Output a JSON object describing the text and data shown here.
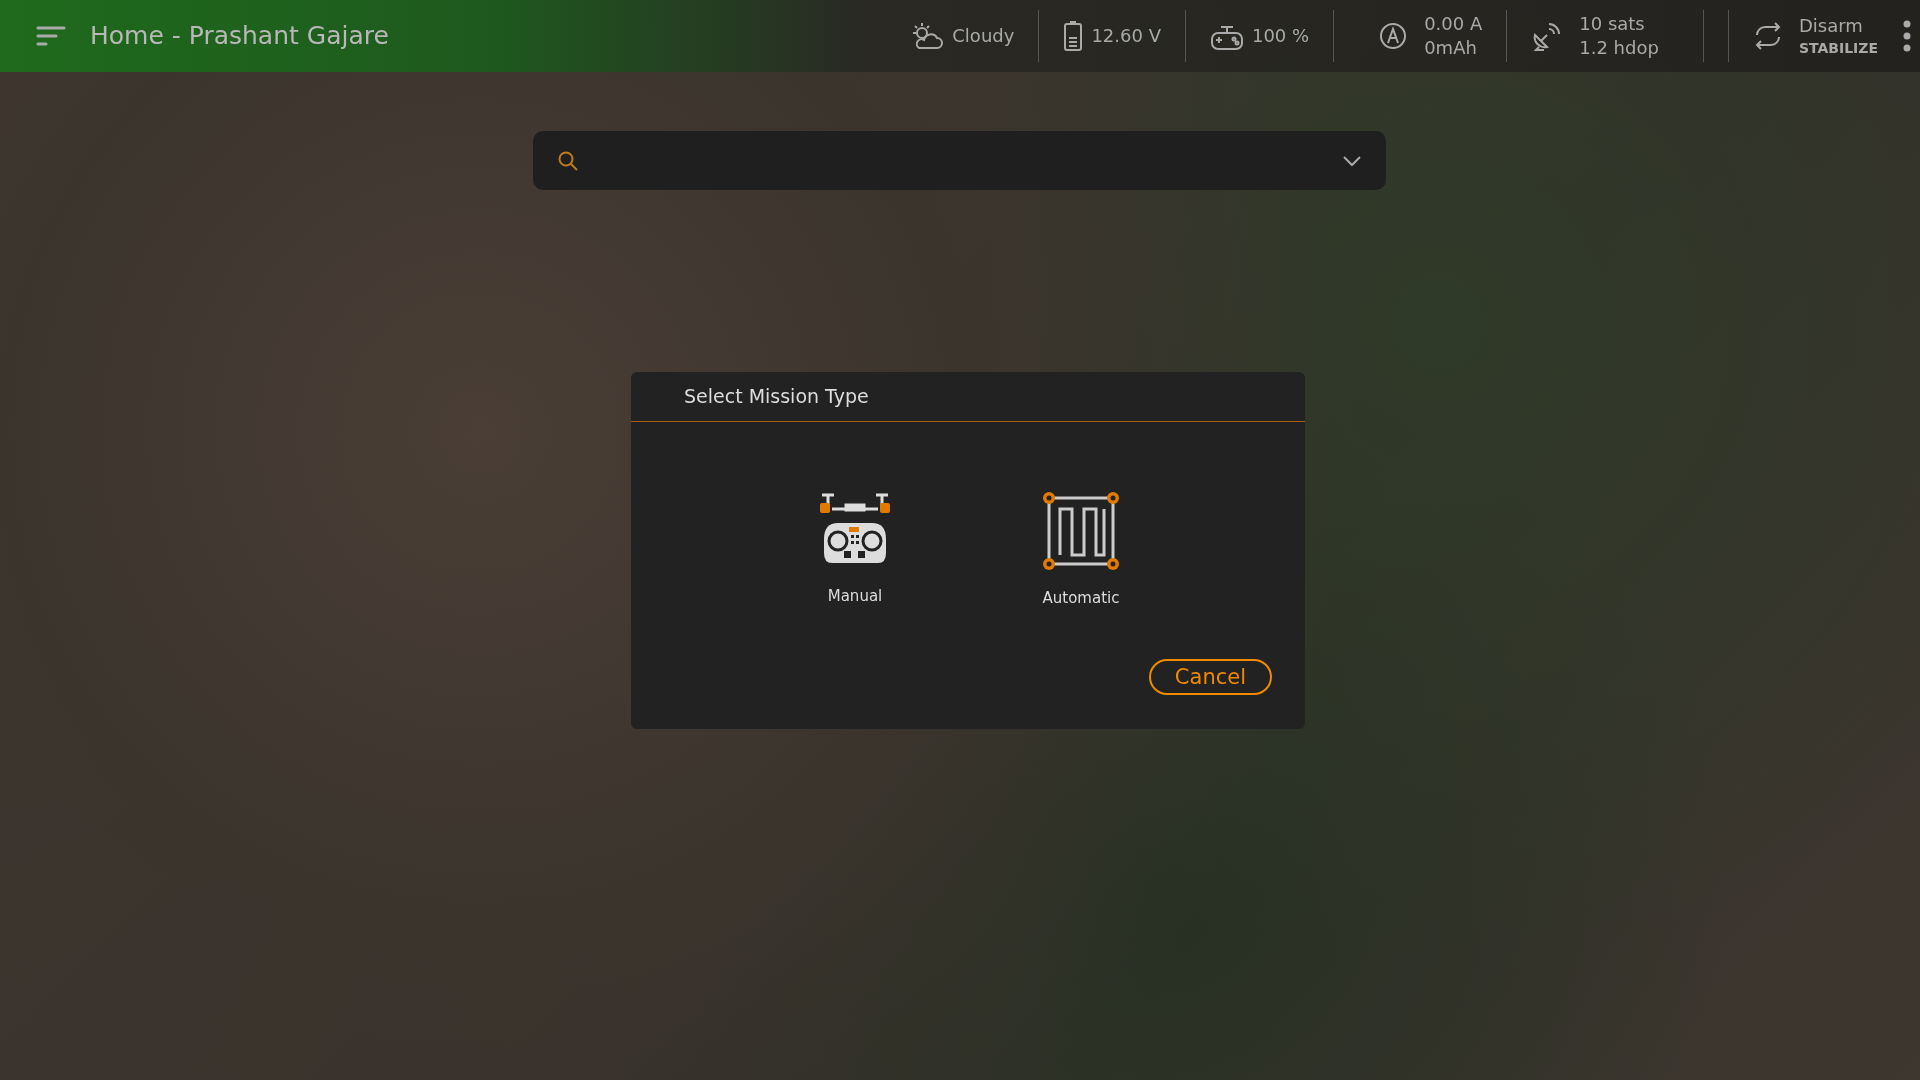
{
  "header": {
    "title": "Home - Prashant Gajare"
  },
  "status": [
    {
      "kind": "weather",
      "lines": [
        "Cloudy"
      ]
    },
    {
      "kind": "battery",
      "lines": [
        "12.60 V"
      ]
    },
    {
      "kind": "controller",
      "lines": [
        "100 %"
      ]
    },
    {
      "kind": "current",
      "lines": [
        "0.00 A",
        "0mAh"
      ]
    },
    {
      "kind": "gps",
      "lines": [
        "10 sats",
        "1.2 hdop"
      ]
    },
    {
      "kind": "mode",
      "lines": [
        "Disarm",
        "STABILIZE"
      ]
    }
  ],
  "dialog": {
    "title": "Select Mission Type",
    "options": [
      {
        "kind": "manual",
        "label": "Manual"
      },
      {
        "kind": "automatic",
        "label": "Automatic"
      }
    ],
    "buttons": [
      "Cancel"
    ]
  }
}
